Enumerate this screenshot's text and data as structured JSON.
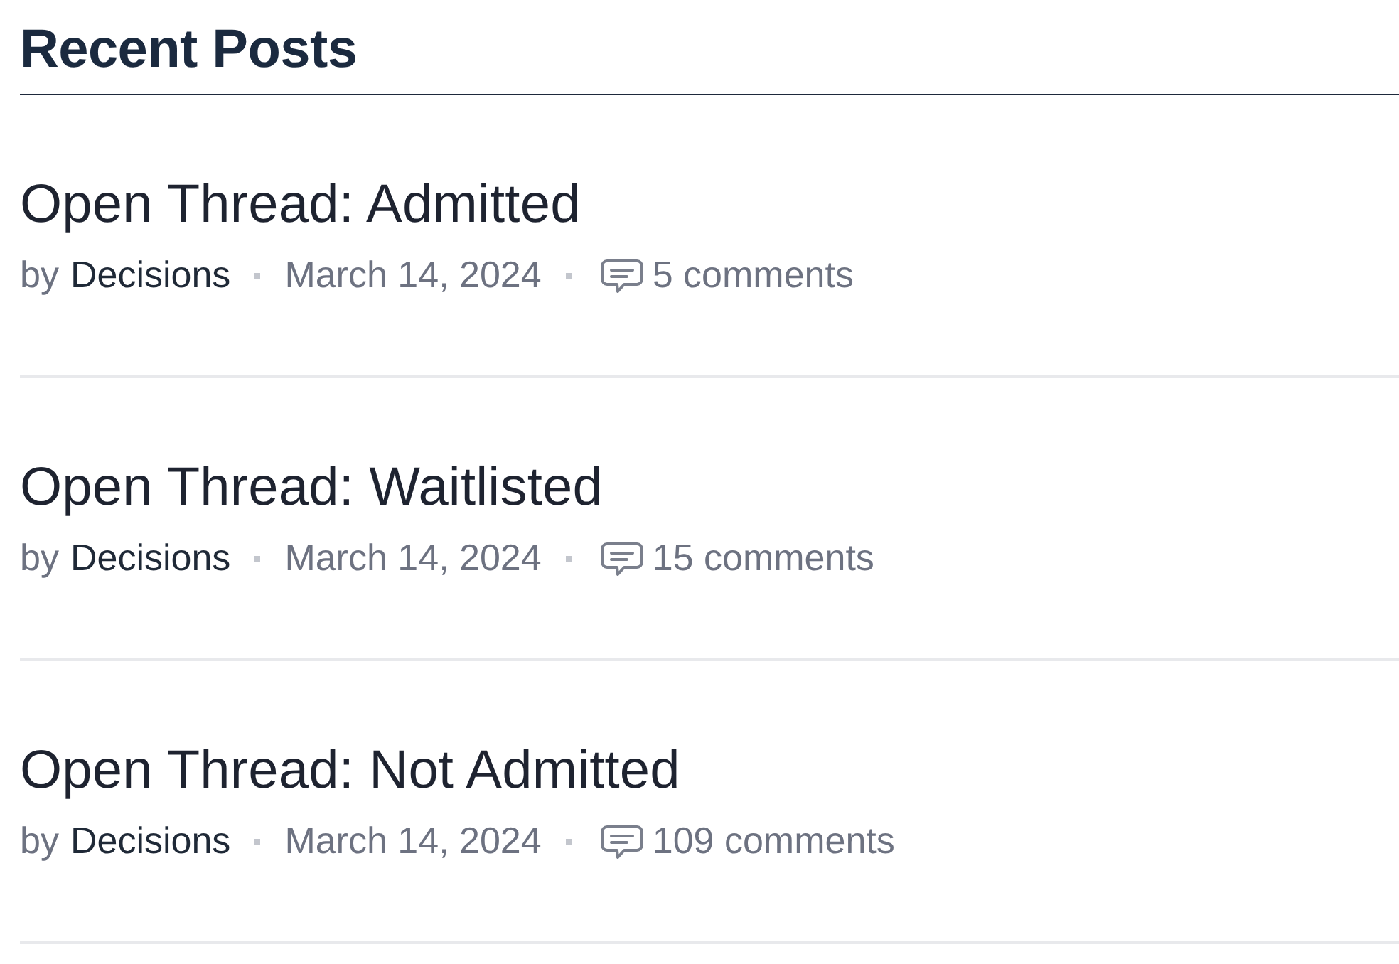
{
  "heading": "Recent Posts",
  "posts": [
    {
      "title": "Open Thread: Admitted",
      "by": "by",
      "author": "Decisions",
      "date": "March 14, 2024",
      "comments": "5 comments"
    },
    {
      "title": "Open Thread: Waitlisted",
      "by": "by",
      "author": "Decisions",
      "date": "March 14, 2024",
      "comments": "15 comments"
    },
    {
      "title": "Open Thread: Not Admitted",
      "by": "by",
      "author": "Decisions",
      "date": "March 14, 2024",
      "comments": "109 comments"
    }
  ]
}
